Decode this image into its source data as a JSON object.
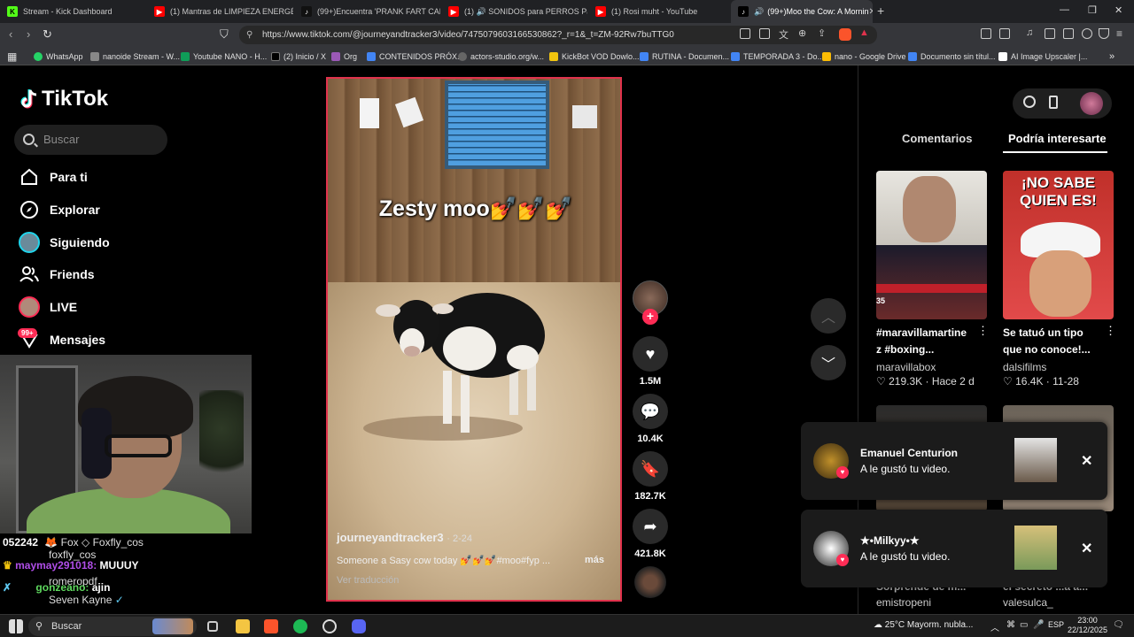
{
  "browser": {
    "tabs": [
      {
        "title": "Stream - Kick Dashboard",
        "color": "#53fc18",
        "letter": "K",
        "active": false
      },
      {
        "title": "(1) Mantras de LIMPIEZA ENERGÉTIC",
        "color": "#ff0000",
        "letter": "▶",
        "active": false
      },
      {
        "title": "(99+)Encuentra 'PRANK FART CALLE'",
        "color": "#111111",
        "letter": "♪",
        "active": false
      },
      {
        "title": "(1) 🔊 SONIDOS para PERROS Para C",
        "color": "#ff0000",
        "letter": "▶",
        "active": false
      },
      {
        "title": "(1) Rosi muht - YouTube",
        "color": "#ff0000",
        "letter": "▶",
        "active": false
      },
      {
        "title": "(99+)Moo the Cow: A Mornin",
        "color": "#111111",
        "letter": "♪",
        "active": true
      }
    ],
    "url": "https://www.tiktok.com/@journeyandtracker3/video/7475079603166530862?_r=1&_t=ZM-92Rw7buTTG0",
    "bookmarks": [
      {
        "label": "WhatsApp",
        "color": "#25d366"
      },
      {
        "label": "nanoide Stream - W...",
        "color": "#888888"
      },
      {
        "label": "Youtube NANO - H...",
        "color": "#0f9d58"
      },
      {
        "label": "(2) Inicio / X",
        "color": "#000000"
      },
      {
        "label": "Org",
        "color": "#9b59b6"
      },
      {
        "label": "CONTENIDOS PRÓX...",
        "color": "#4285f4"
      },
      {
        "label": "actors-studio.org/w...",
        "color": "#666666"
      },
      {
        "label": "KickBot VOD Dowlo...",
        "color": "#f1c40f"
      },
      {
        "label": "RUTINA - Documen...",
        "color": "#4285f4"
      },
      {
        "label": "TEMPORADA 3 - Do...",
        "color": "#4285f4"
      },
      {
        "label": "nano - Google Drive",
        "color": "#fbbc04"
      },
      {
        "label": "Documento sin títul...",
        "color": "#4285f4"
      },
      {
        "label": "AI Image Upscaler |...",
        "color": "#ffffff"
      }
    ]
  },
  "tiktok": {
    "logo": "TikTok",
    "search_placeholder": "Buscar",
    "nav": [
      {
        "label": "Para ti",
        "icon": "home-icon"
      },
      {
        "label": "Explorar",
        "icon": "compass-icon"
      },
      {
        "label": "Siguiendo",
        "icon": "following-avatar-icon"
      },
      {
        "label": "Friends",
        "icon": "friends-icon"
      },
      {
        "label": "LIVE",
        "icon": "live-avatar-icon"
      },
      {
        "label": "Mensajes",
        "icon": "messages-icon"
      }
    ],
    "messages_badge": "99+",
    "video": {
      "overlay_text": "Zesty moo💅💅💅",
      "username": "journeyandtracker3",
      "date": "· 2-24",
      "description": "Someone a Sasy cow today 💅💅💅#moo#fyp ...",
      "more": "más",
      "translate": "Ver traducción"
    },
    "actions": {
      "likes": "1.5M",
      "comments": "10.4K",
      "saves": "182.7K",
      "shares": "421.8K"
    },
    "panel_tabs": [
      "Comentarios",
      "Podría interesarte"
    ],
    "recommended": [
      {
        "title": "#maravillamartine z #boxing...",
        "author": "maravillabox",
        "likes": "219.3K",
        "date": "Hace 2 d"
      },
      {
        "title": "Se tatuó un tipo que no conoce!...",
        "author": "dalsifilms",
        "likes": "16.4K",
        "date": "11-28"
      }
    ],
    "thumb2_caption": "¡NO SABE QUIEN ES!",
    "thumb1_badge": "35",
    "hidden_authors": [
      "emistropeni",
      "valesulca_"
    ],
    "hidden_titles": [
      "Sorprende de m...",
      "el secreto ...a a..."
    ],
    "notifications": [
      {
        "name": "Emanuel Centurion",
        "text": "A le gustó tu video."
      },
      {
        "name": "★•Milkyy•★",
        "text": "A le gustó tu video."
      }
    ]
  },
  "stream_overlay": {
    "chat": [
      {
        "user": "052242",
        "text": "🦊 Fox ◇ Foxfly_cos",
        "color": "#ffffff"
      },
      {
        "user": "foxfly_cos",
        "text": "",
        "color": "#dddddd"
      },
      {
        "user": "maymay291018:",
        "text": "MUUUY",
        "color": "#b04ee8"
      },
      {
        "user": "romeropdf",
        "text": "",
        "color": "#dddddd"
      },
      {
        "user": "gonzeano:",
        "text": "ajin",
        "color": "#5ed85e"
      },
      {
        "user": "Seven Kayne",
        "text": "",
        "color": "#dddddd"
      }
    ]
  },
  "taskbar": {
    "search": "Buscar",
    "weather": "25°C  Mayorm. nubla...",
    "lang": "ESP",
    "time": "23:00",
    "date": "22/12/2025"
  }
}
